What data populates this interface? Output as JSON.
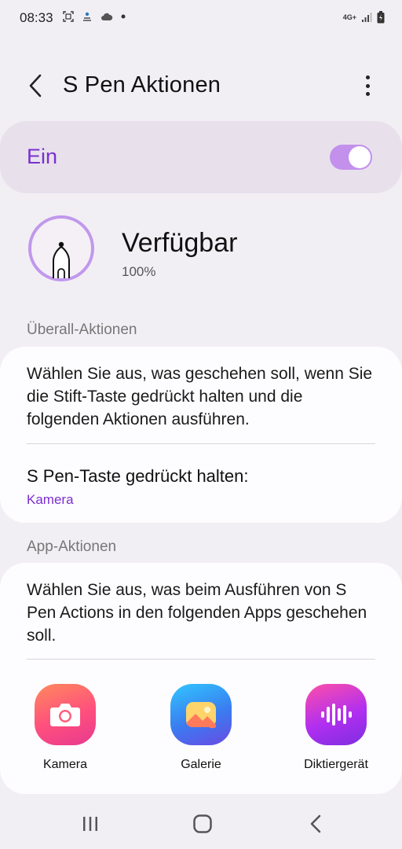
{
  "status_bar": {
    "time": "08:33",
    "network": "4G+",
    "left_icons": [
      "screenshot-icon",
      "person-upload-icon",
      "cloud-icon",
      "dot-icon"
    ],
    "right_icons": [
      "network-type-icon",
      "signal-icon",
      "battery-charging-icon"
    ]
  },
  "header": {
    "title": "S Pen Aktionen"
  },
  "master_switch": {
    "label": "Ein",
    "on": true,
    "accent": "#7b2fd0"
  },
  "pen": {
    "status": "Verfügbar",
    "battery": "100%"
  },
  "anywhere_actions": {
    "header": "Überall-Aktionen",
    "description": "Wählen Sie aus, was geschehen soll, wenn Sie die Stift-Taste gedrückt halten und die folgenden Aktionen ausführen.",
    "hold_title": "S Pen-Taste gedrückt halten:",
    "hold_value": "Kamera"
  },
  "app_actions": {
    "header": "App-Aktionen",
    "description": "Wählen Sie aus, was beim Ausführen von S Pen Actions in den folgenden Apps geschehen soll.",
    "apps": [
      {
        "label": "Kamera",
        "icon": "camera-icon"
      },
      {
        "label": "Galerie",
        "icon": "gallery-icon"
      },
      {
        "label": "Diktiergerät",
        "icon": "voice-recorder-icon"
      }
    ]
  },
  "nav": {
    "items": [
      "recents-icon",
      "home-icon",
      "back-icon"
    ]
  }
}
